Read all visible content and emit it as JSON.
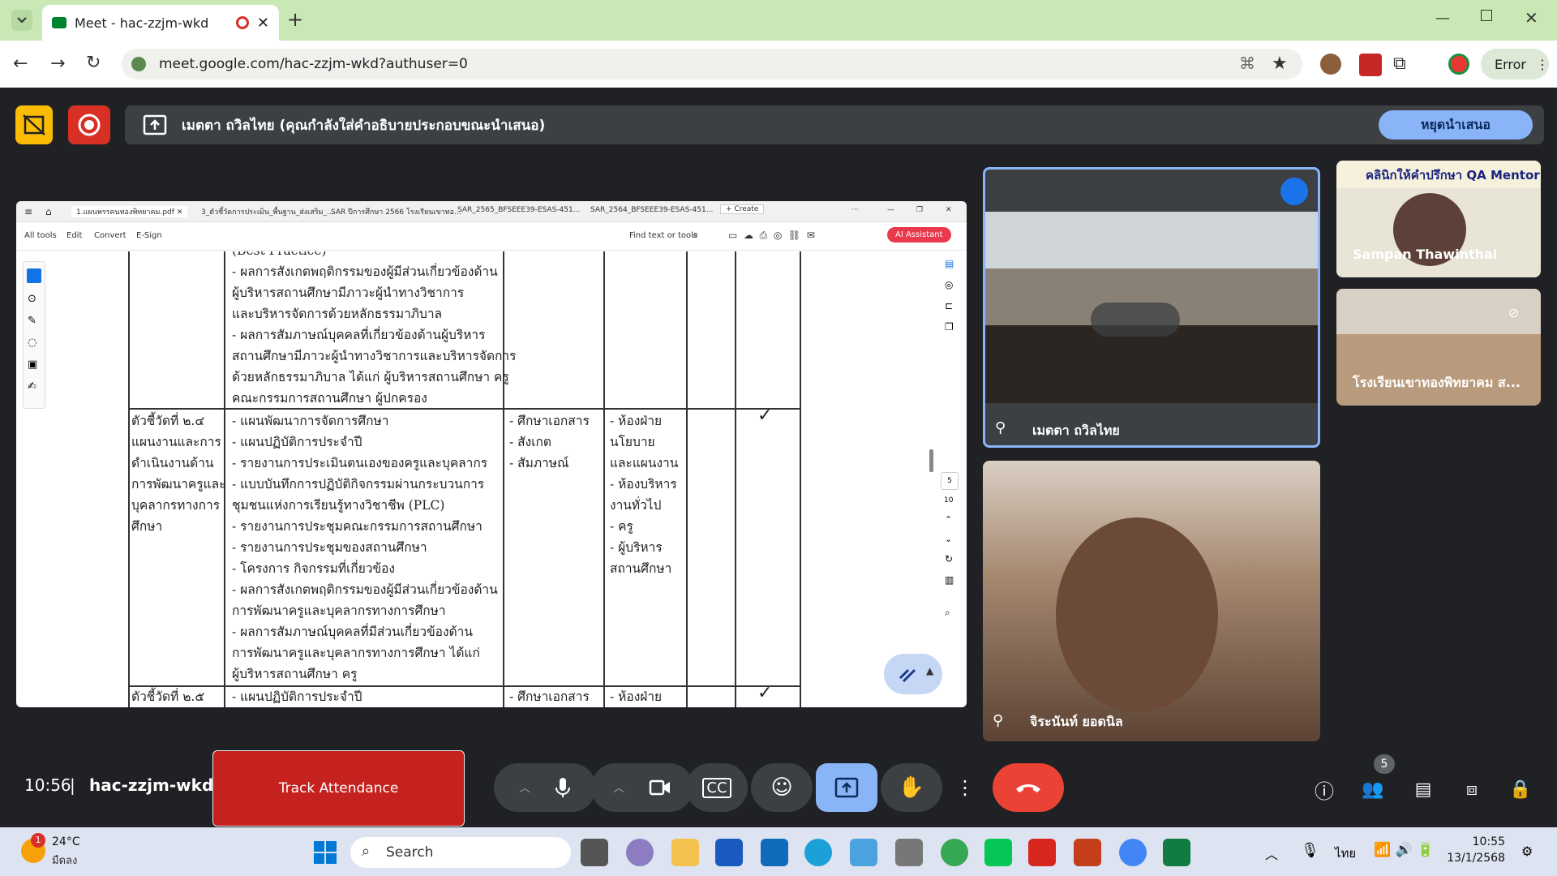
{
  "browser": {
    "tab_title": "Meet - hac-zzjm-wkd",
    "url": "meet.google.com/hac-zzjm-wkd?authuser=0",
    "error_label": "Error"
  },
  "presenting": {
    "text": "เมตตา ถวิลไทย (คุณกำลังใส่คำอธิบายประกอบขณะนำเสนอ)",
    "stop_label": "หยุดนำเสนอ"
  },
  "pdf": {
    "tabs": [
      "1.แผนพรรคนทองพิทยาคม.pdf",
      "3_ตัวชี้วัดการประเมิน_พื้นฐาน_ส่งเสริม_...",
      "SAR ปีการศึกษา 2566 โรงเรียนเขาทอ...",
      "SAR_2565_BFSEEE39-ESAS-451...",
      "SAR_2564_BFSEEE39-ESAS-451...",
      "Create"
    ],
    "menu": [
      "All tools",
      "Edit",
      "Convert",
      "E-Sign"
    ],
    "find": "Find text or tools",
    "ai": "AI Assistant",
    "page_num": "5",
    "page_total": "10",
    "lines_top": [
      "(Best Practice)",
      "- ผลการสังเกตพฤติกรรมของผู้มีส่วนเกี่ยวข้องด้าน",
      "ผู้บริหารสถานศึกษามีภาวะผู้นำทางวิชาการ",
      "และบริหารจัดการด้วยหลักธรรมาภิบาล",
      "- ผลการสัมภาษณ์บุคคลที่เกี่ยวข้องด้านผู้บริหาร",
      "สถานศึกษามีภาวะผู้นำทางวิชาการและบริหารจัดการ",
      "ด้วยหลักธรรมาภิบาล ได้แก่ ผู้บริหารสถานศึกษา ครู",
      "คณะกรรมการสถานศึกษา ผู้ปกครอง"
    ],
    "indicator": [
      "ตัวชี้วัดที่ ๒.๔",
      "แผนงานและการ",
      "ดำเนินงานด้าน",
      "การพัฒนาครูและ",
      "บุคลากรทางการ",
      "ศึกษา"
    ],
    "evidence": [
      "- แผนพัฒนาการจัดการศึกษา",
      "- แผนปฏิบัติการประจำปี",
      "- รายงานการประเมินตนเองของครูและบุคลากร",
      "- แบบบันทึกการปฏิบัติกิจกรรมผ่านกระบวนการ",
      "ชุมชนแห่งการเรียนรู้ทางวิชาชีพ (PLC)",
      "- รายงานการประชุมคณะกรรมการสถานศึกษา",
      "- รายงานการประชุมของสถานศึกษา",
      "- โครงการ กิจกรรมที่เกี่ยวข้อง",
      "- ผลการสังเกตพฤติกรรมของผู้มีส่วนเกี่ยวข้องด้าน",
      "การพัฒนาครูและบุคลากรทางการศึกษา",
      "- ผลการสัมภาษณ์บุคคลที่มีส่วนเกี่ยวข้องด้าน",
      "การพัฒนาครูและบุคลากรทางการศึกษา ได้แก่",
      "ผู้บริหารสถานศึกษา ครู"
    ],
    "method": [
      "- ศึกษาเอกสาร",
      "- สังเกต",
      "- สัมภาษณ์"
    ],
    "source": [
      "- ห้องฝ่าย",
      "นโยบาย",
      "และแผนงาน",
      "- ห้องบริหาร",
      "งานทั่วไป",
      "- ครู",
      "- ผู้บริหาร",
      "สถานศึกษา"
    ],
    "check": "✓",
    "next_indicator": "ตัวชี้วัดที่ ๒.๕",
    "next_evidence": "- แผนปฏิบัติการประจำปี",
    "next_method": "- ศึกษาเอกสาร",
    "next_source": "- ห้องฝ่าย"
  },
  "participants": [
    {
      "name": "เมตตา ถวิลไทย"
    },
    {
      "name": "จิระนันท์ ยอดนิล"
    },
    {
      "name": "Sampan Thawinthai",
      "banner": "คลินิกให้คำปรึกษา QA Mentor"
    },
    {
      "name": "โรงเรียนเขาทองพิทยาคม ส..."
    }
  ],
  "meeting": {
    "time": "10:56",
    "code": "hac-zzjm-wkd",
    "track_label": "Track Attendance",
    "people_count": "5"
  },
  "taskbar": {
    "temp": "24°C",
    "weather": "มืดลง",
    "weather_badge": "1",
    "search": "Search",
    "lang": "ไทย",
    "time": "10:55",
    "date": "13/1/2568"
  },
  "colors": {
    "tabbar": "#c9e8b5",
    "accent": "#8ab4f8",
    "end_call": "#ea4335",
    "track": "#c5221f"
  }
}
